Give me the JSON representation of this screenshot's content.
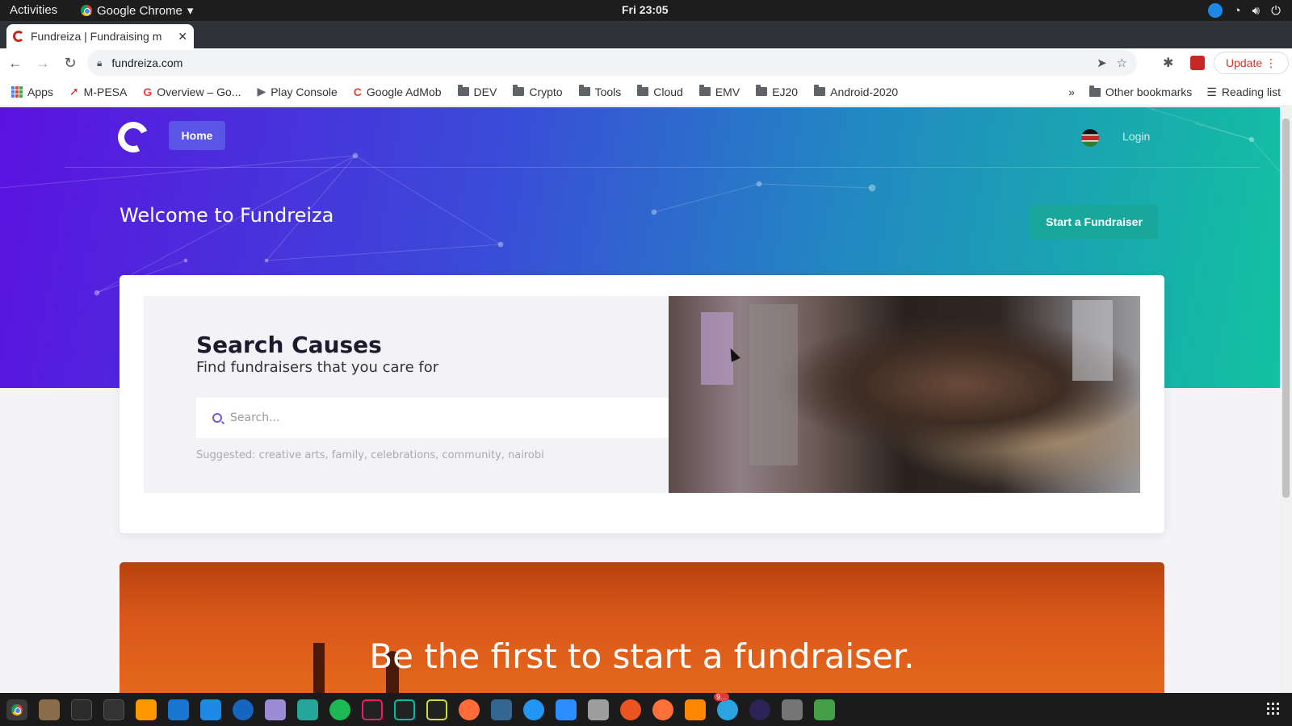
{
  "system": {
    "activities": "Activities",
    "app_name": "Google Chrome",
    "clock": "Fri 23:05"
  },
  "browser": {
    "tab_title": "Fundreiza | Fundraising m",
    "url": "fundreiza.com",
    "update_label": "Update",
    "bookmarks": [
      "Apps",
      "M-PESA",
      "Overview – Go...",
      "Play Console",
      "Google AdMob",
      "DEV",
      "Crypto",
      "Tools",
      "Cloud",
      "EMV",
      "EJ20",
      "Android-2020"
    ],
    "overflow": "»",
    "other_bookmarks": "Other bookmarks",
    "reading_list": "Reading list"
  },
  "site": {
    "nav_home": "Home",
    "nav_login": "Login",
    "welcome": "Welcome to Fundreiza",
    "start_button": "Start a Fundraiser",
    "search_title": "Search Causes",
    "search_subtitle": "Find fundraisers that you care for",
    "search_placeholder": "Search...",
    "suggested": "Suggested: creative arts, family, celebrations, community, nairobi",
    "banner_title": "Be the first to start a fundraiser."
  },
  "colors": {
    "hero_start": "#5b12e0",
    "hero_end": "#12c2a0",
    "home_button": "#5a55e6",
    "start_button": "#19a79c",
    "banner": "#d9571a"
  },
  "dock_icons": [
    "chrome-icon",
    "files-icon",
    "terminal-icon",
    "system-monitor-icon",
    "sublime-icon",
    "screenshot-icon",
    "vscode-icon",
    "wps-icon",
    "crystal-icon",
    "android-studio-icon",
    "spotify-icon",
    "intellij-icon",
    "datagrip-icon",
    "pycharm-icon",
    "postman-icon",
    "postgres-icon",
    "safari-icon",
    "zoom-icon",
    "camera-icon",
    "ubuntu-icon",
    "firefox-icon",
    "vlc-icon",
    "telegram-icon",
    "eclipse-icon",
    "calculator-icon",
    "spreadsheet-icon"
  ],
  "telegram_badge": "9..."
}
